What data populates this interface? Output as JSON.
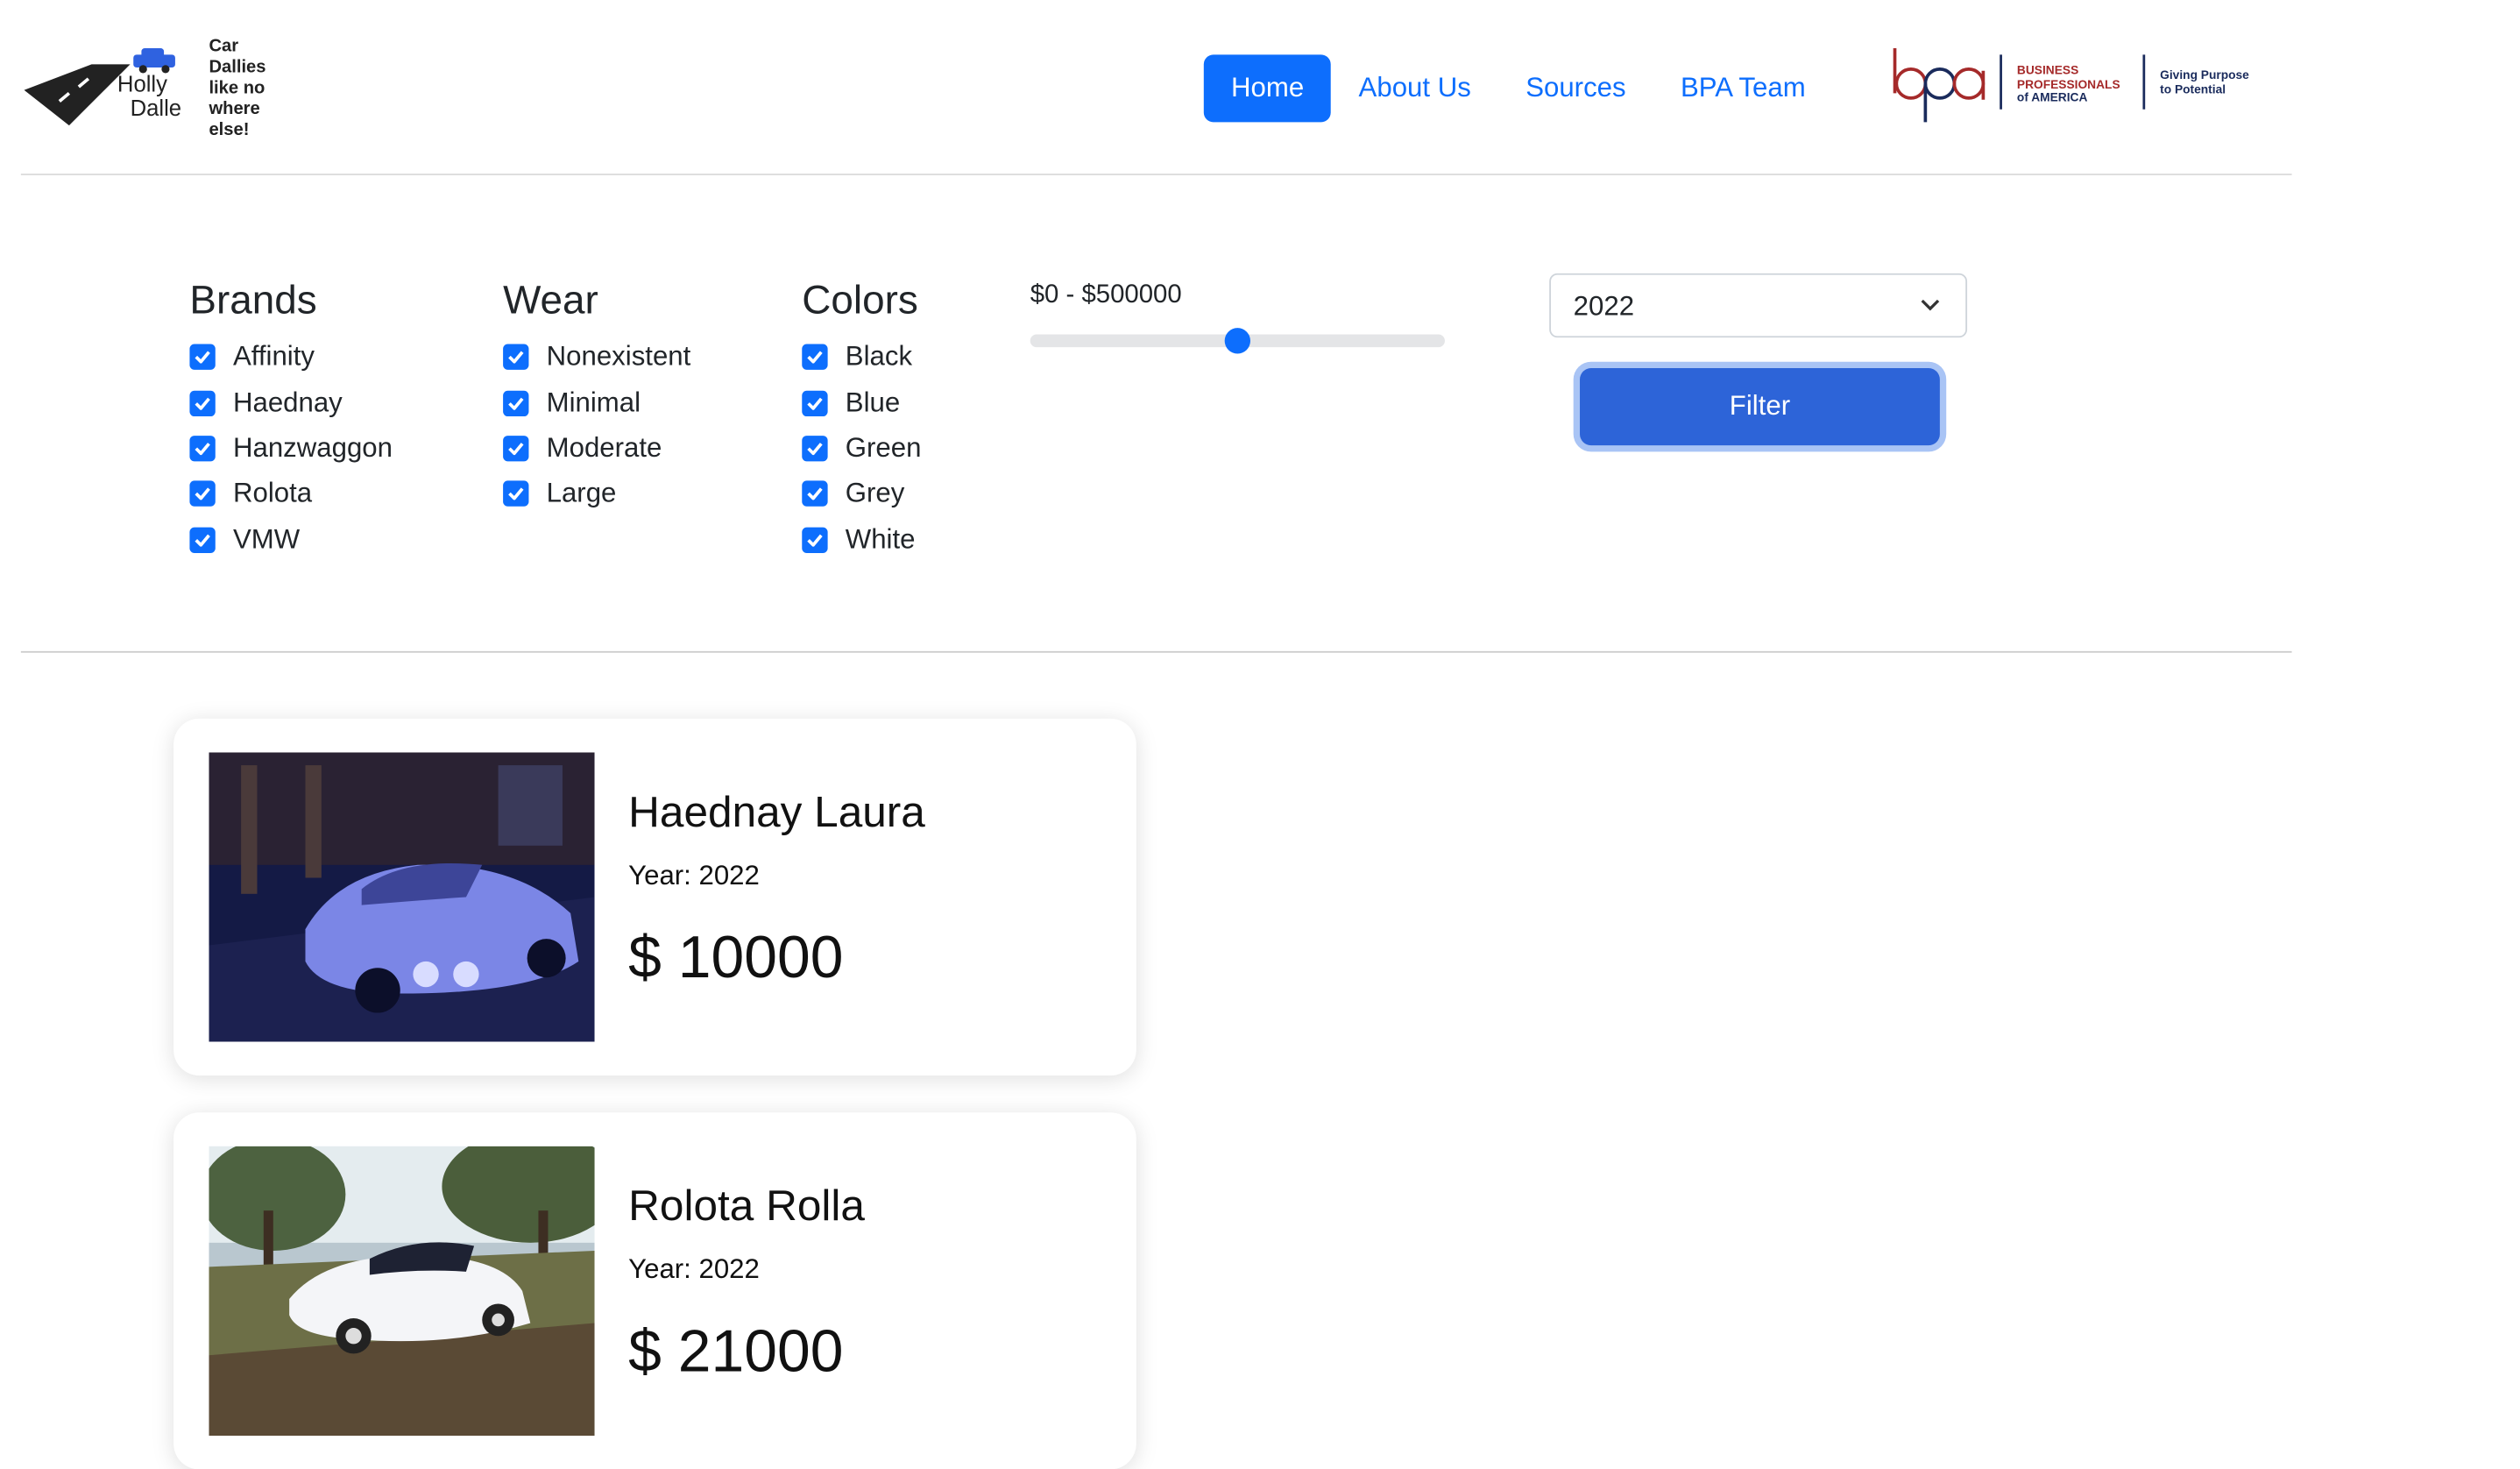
{
  "header": {
    "logo": {
      "name_line1": "Holly",
      "name_line2": "Dalle",
      "tagline": [
        "Car",
        "Dallies",
        "like no",
        "where",
        "else!"
      ]
    },
    "nav": [
      {
        "label": "Home",
        "active": true
      },
      {
        "label": "About Us",
        "active": false
      },
      {
        "label": "Sources",
        "active": false
      },
      {
        "label": "BPA Team",
        "active": false
      }
    ],
    "sponsor": {
      "lines": [
        "BUSINESS",
        "PROFESSIONALS",
        "of AMERICA"
      ],
      "motto": [
        "Giving Purpose",
        "to Potential"
      ]
    }
  },
  "filters": {
    "brands": {
      "title": "Brands",
      "options": [
        {
          "label": "Affinity",
          "checked": true
        },
        {
          "label": "Haednay",
          "checked": true
        },
        {
          "label": "Hanzwaggon",
          "checked": true
        },
        {
          "label": "Rolota",
          "checked": true
        },
        {
          "label": "VMW",
          "checked": true
        }
      ]
    },
    "wear": {
      "title": "Wear",
      "options": [
        {
          "label": "Nonexistent",
          "checked": true
        },
        {
          "label": "Minimal",
          "checked": true
        },
        {
          "label": "Moderate",
          "checked": true
        },
        {
          "label": "Large",
          "checked": true
        }
      ]
    },
    "colors": {
      "title": "Colors",
      "options": [
        {
          "label": "Black",
          "checked": true
        },
        {
          "label": "Blue",
          "checked": true
        },
        {
          "label": "Green",
          "checked": true
        },
        {
          "label": "Grey",
          "checked": true
        },
        {
          "label": "White",
          "checked": true
        }
      ]
    },
    "price": {
      "label": "$0 - $500000",
      "slider_fraction": 0.5
    },
    "year_select": {
      "value": "2022"
    },
    "filter_button": "Filter"
  },
  "cars": [
    {
      "title": "Haednay Laura",
      "year": "Year: 2022",
      "price": "$ 10000",
      "photo": "blue-car-photo"
    },
    {
      "title": "Rolota Rolla",
      "year": "Year: 2022",
      "price": "$ 21000",
      "photo": "white-car-photo"
    }
  ],
  "colors": {
    "accent": "#0d6efd",
    "button": "#2d64d8"
  }
}
